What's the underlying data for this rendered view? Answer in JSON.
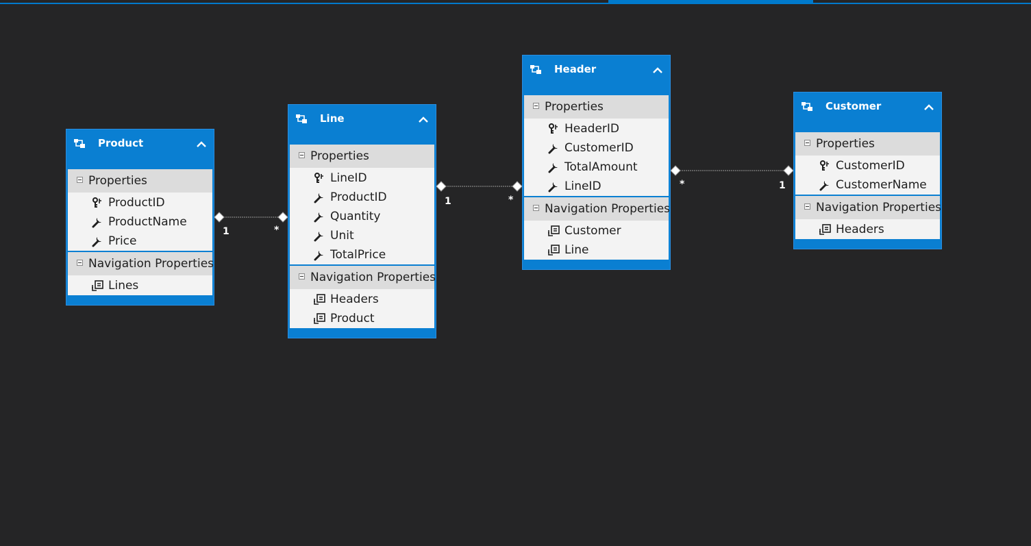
{
  "diagram": {
    "entities": [
      {
        "id": "product",
        "title": "Product",
        "properties_label": "Properties",
        "properties": [
          {
            "name": "ProductID",
            "icon": "key-icon"
          },
          {
            "name": "ProductName",
            "icon": "wrench-icon"
          },
          {
            "name": "Price",
            "icon": "wrench-icon"
          }
        ],
        "navigation_label": "Navigation Properties",
        "navigation": [
          {
            "name": "Lines",
            "icon": "navigation-property-icon"
          }
        ]
      },
      {
        "id": "line",
        "title": "Line",
        "properties_label": "Properties",
        "properties": [
          {
            "name": "LineID",
            "icon": "key-icon"
          },
          {
            "name": "ProductID",
            "icon": "wrench-icon"
          },
          {
            "name": "Quantity",
            "icon": "wrench-icon"
          },
          {
            "name": "Unit",
            "icon": "wrench-icon"
          },
          {
            "name": "TotalPrice",
            "icon": "wrench-icon"
          }
        ],
        "navigation_label": "Navigation Properties",
        "navigation": [
          {
            "name": "Headers",
            "icon": "navigation-property-icon"
          },
          {
            "name": "Product",
            "icon": "navigation-property-icon"
          }
        ]
      },
      {
        "id": "header",
        "title": "Header",
        "properties_label": "Properties",
        "properties": [
          {
            "name": "HeaderID",
            "icon": "key-icon"
          },
          {
            "name": "CustomerID",
            "icon": "wrench-icon"
          },
          {
            "name": "TotalAmount",
            "icon": "wrench-icon"
          },
          {
            "name": "LineID",
            "icon": "wrench-icon"
          }
        ],
        "navigation_label": "Navigation Properties",
        "navigation": [
          {
            "name": "Customer",
            "icon": "navigation-property-icon"
          },
          {
            "name": "Line",
            "icon": "navigation-property-icon"
          }
        ]
      },
      {
        "id": "customer",
        "title": "Customer",
        "properties_label": "Properties",
        "properties": [
          {
            "name": "CustomerID",
            "icon": "key-icon"
          },
          {
            "name": "CustomerName",
            "icon": "wrench-icon"
          }
        ],
        "navigation_label": "Navigation Properties",
        "navigation": [
          {
            "name": "Headers",
            "icon": "navigation-property-icon"
          }
        ]
      }
    ],
    "associations": [
      {
        "from": "product",
        "to": "line",
        "from_multiplicity": "1",
        "to_multiplicity": "*"
      },
      {
        "from": "line",
        "to": "header",
        "from_multiplicity": "1",
        "to_multiplicity": "*"
      },
      {
        "from": "header",
        "to": "customer",
        "from_multiplicity": "*",
        "to_multiplicity": "1"
      }
    ],
    "colors": {
      "canvas": "#252526",
      "entity_header": "#0a7fd2",
      "section_header": "#dcdcdc",
      "row_background": "#f3f3f3",
      "connector": "#9a9a9a"
    }
  }
}
